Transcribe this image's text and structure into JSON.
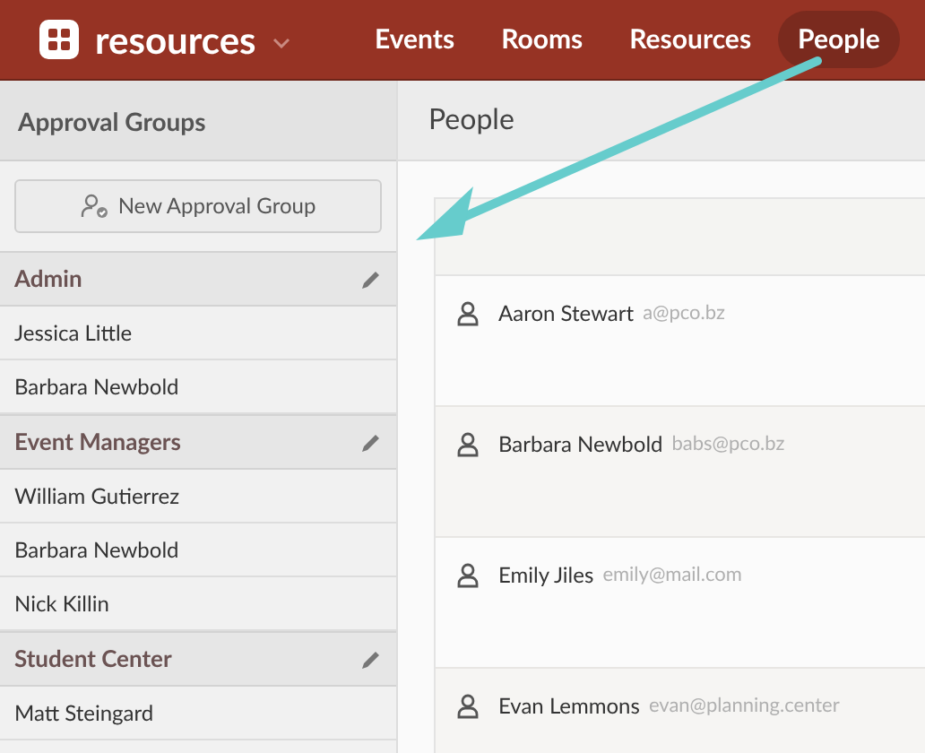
{
  "app": {
    "name": "resources"
  },
  "nav": [
    {
      "label": "Events",
      "selected": false
    },
    {
      "label": "Rooms",
      "selected": false
    },
    {
      "label": "Resources",
      "selected": false
    },
    {
      "label": "People",
      "selected": true
    }
  ],
  "sidebar": {
    "title": "Approval Groups",
    "new_button": "New Approval Group",
    "groups": [
      {
        "name": "Admin",
        "children": [
          {
            "name": "Jessica Little"
          },
          {
            "name": "Barbara Newbold"
          }
        ]
      },
      {
        "name": "Event Managers",
        "children": [
          {
            "name": "William Gutierrez"
          },
          {
            "name": "Barbara Newbold"
          },
          {
            "name": "Nick Killin"
          }
        ]
      },
      {
        "name": "Student Center",
        "children": [
          {
            "name": "Matt Steingard"
          }
        ]
      }
    ]
  },
  "main": {
    "title": "People",
    "people": [
      {
        "name": "Aaron Stewart",
        "email": "a@pco.bz"
      },
      {
        "name": "Barbara Newbold",
        "email": "babs@pco.bz"
      },
      {
        "name": "Emily Jiles",
        "email": "emily@mail.com"
      },
      {
        "name": "Evan Lemmons",
        "email": "evan@planning.center"
      }
    ]
  }
}
